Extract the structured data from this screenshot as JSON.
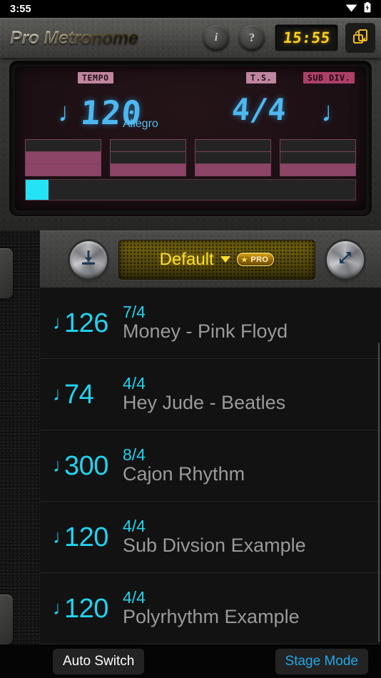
{
  "status_bar": {
    "clock": "3:55",
    "wifi_icon": "wifi-icon",
    "battery_icon": "battery-charging-icon"
  },
  "header": {
    "app_title": "Pro Metronome",
    "info_label": "i",
    "help_label": "?",
    "timer_value": "15:55",
    "rotate_icon": "screen-rotation-icon"
  },
  "display": {
    "tempo_tag": "TEMPO",
    "ts_tag": "T.S.",
    "subdiv_tag": "SUB DIV.",
    "beat_note_glyph": "♩",
    "bpm_value": "120",
    "tempo_word": "Allegro",
    "time_signature": "4/4",
    "subdiv_glyph": "♩",
    "accent_color": "#4db8f0",
    "bar_fill_color": "#8c4566",
    "sub_marker_color": "#25e2f5",
    "beats": [
      {
        "levels": 3,
        "filled": 2
      },
      {
        "levels": 3,
        "filled": 1
      },
      {
        "levels": 3,
        "filled": 1
      },
      {
        "levels": 3,
        "filled": 1
      }
    ],
    "sub_cells": [
      {
        "on": true
      },
      {
        "on": false
      },
      {
        "on": false
      },
      {
        "on": false
      },
      {
        "on": false
      },
      {
        "on": false
      },
      {
        "on": false
      },
      {
        "on": false
      },
      {
        "on": false
      },
      {
        "on": false
      },
      {
        "on": false
      },
      {
        "on": false
      },
      {
        "on": false
      }
    ]
  },
  "preset_bar": {
    "save_icon": "save-icon",
    "preset_name": "Default",
    "dropdown_icon": "chevron-down-icon",
    "pro_star": "★",
    "pro_label": "PRO",
    "expand_icon": "expand-icon",
    "preset_text_color": "#ffe02e"
  },
  "presets": [
    {
      "note": "♩",
      "bpm": "126",
      "ts": "7/4",
      "title": "Money - Pink Floyd"
    },
    {
      "note": "♩",
      "bpm": "74",
      "ts": "4/4",
      "title": "Hey Jude - Beatles"
    },
    {
      "note": "♩",
      "bpm": "300",
      "ts": "8/4",
      "title": "Cajon Rhythm"
    },
    {
      "note": "♩",
      "bpm": "120",
      "ts": "4/4",
      "title": "Sub Divsion Example"
    },
    {
      "note": "♩",
      "bpm": "120",
      "ts": "4/4",
      "title": "Polyrhythm Example"
    }
  ],
  "bottom_bar": {
    "auto_switch_label": "Auto Switch",
    "stage_mode_label": "Stage Mode",
    "stage_mode_color": "#22a7e8"
  }
}
